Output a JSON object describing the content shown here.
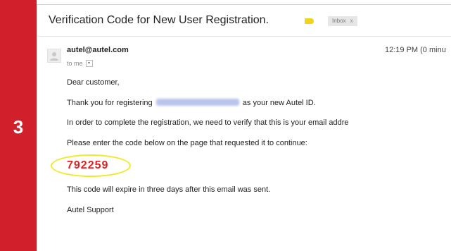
{
  "step": {
    "number": "3"
  },
  "email": {
    "subject": "Verification Code for New User Registration.",
    "label_tag_color": "#f3d21c",
    "inbox_chip": {
      "label": "Inbox",
      "close": "x"
    },
    "sender": "autel@autel.com",
    "recipient": "to me",
    "time": "12:19 PM (0 minu",
    "body": {
      "greeting": "Dear customer,",
      "thanks_before": "Thank you for registering",
      "thanks_after": "as your new Autel ID.",
      "verify_line": "In order to complete the registration, we need to verify that this is your email addre",
      "instruction": "Please enter the code below on the page that requested it to continue:",
      "code": "792259",
      "expiry": "This code will expire in three days after this email was sent.",
      "signature": "Autel Support"
    }
  },
  "colors": {
    "step_bar": "#d11f2b",
    "code": "#e02020",
    "highlight_ring": "#f0ea2a"
  },
  "icons": {
    "avatar": "person-icon",
    "recipient_dropdown": "chevron-down-icon"
  }
}
